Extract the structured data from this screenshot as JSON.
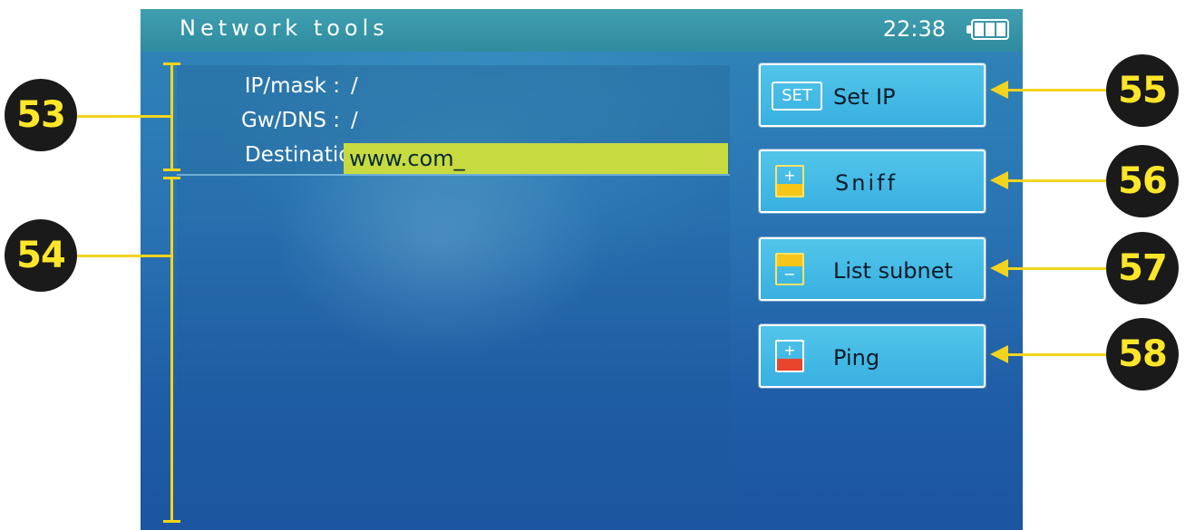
{
  "status_bar": {
    "title": "Network tools",
    "clock": "22:38",
    "battery_icon": "battery-full-icon"
  },
  "info": {
    "ip_mask_label": "IP/mask :",
    "ip_mask_value": "/",
    "gw_dns_label": "Gw/DNS :",
    "gw_dns_value": "/",
    "destination_label": "Destination :",
    "destination_value": "www.com_"
  },
  "menu": [
    {
      "label": "Set IP",
      "icon": "SET"
    },
    {
      "label": "Sniff",
      "icon_symbol": "+"
    },
    {
      "label": "List subnet",
      "icon_symbol": "−"
    },
    {
      "label": "Ping",
      "icon_symbol": "+"
    }
  ],
  "callouts": [
    "53",
    "54",
    "55",
    "56",
    "57",
    "58"
  ],
  "colors": {
    "accent_yellow": "#f3d41c",
    "input_highlight": "#c7da3f",
    "button_blue": "#45bce6",
    "ping_red": "#e8452a",
    "sniff_yellow": "#f5c518"
  }
}
